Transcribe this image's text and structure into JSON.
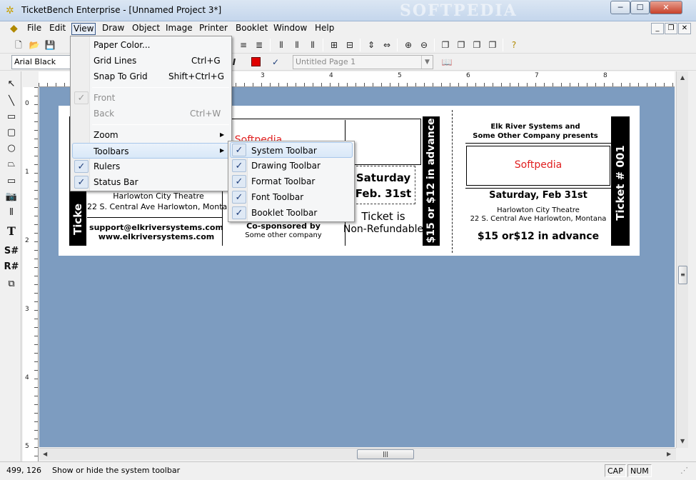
{
  "window": {
    "title": "TicketBench Enterprise - [Unnamed Project 3*]",
    "watermark": "SOFTPEDIA",
    "min": "─",
    "max": "☐",
    "close": "✕"
  },
  "menubar": {
    "items": [
      "File",
      "Edit",
      "View",
      "Draw",
      "Object",
      "Image",
      "Printer",
      "Booklet",
      "Window",
      "Help"
    ],
    "mdi": [
      "_",
      "❐",
      "✕"
    ]
  },
  "toolbar": {
    "font_name": "Arial Black",
    "page_name": "Untitled Page 1"
  },
  "view_menu": {
    "paper_color": "Paper Color...",
    "grid_lines": "Grid Lines",
    "grid_lines_sc": "Ctrl+G",
    "snap_to_grid": "Snap To Grid",
    "snap_to_grid_sc": "Shift+Ctrl+G",
    "front": "Front",
    "back": "Back",
    "back_sc": "Ctrl+W",
    "zoom": "Zoom",
    "toolbars": "Toolbars",
    "rulers": "Rulers",
    "status_bar": "Status Bar"
  },
  "toolbars_submenu": {
    "system": "System Toolbar",
    "drawing": "Drawing Toolbar",
    "format": "Format Toolbar",
    "font": "Font Toolbar",
    "booklet": "Booklet Toolbar"
  },
  "ruler": {
    "h": [
      "3",
      "4",
      "5",
      "6",
      "7",
      "8"
    ],
    "v": [
      "0",
      "1",
      "2",
      "3",
      "4",
      "5"
    ]
  },
  "ticket": {
    "left_stripe": "Ticke",
    "partial_softpedia": "Softpedia",
    "venue": "Harlowton City Theatre",
    "address": "22 S. Central Ave   Harlowton, Montana",
    "email": "support@elkriversystems.com",
    "web": "www.elkriversystems.com",
    "cosponsored": "Co-sponsored by",
    "other_company": "Some other company",
    "day": "Saturday",
    "date": "Feb. 31st",
    "ticket_is": "Ticket is",
    "non_refundable": "Non-Refundable",
    "price_vertical": "$15 or $12 in advance",
    "stub_presents_1": "Elk River Systems and",
    "stub_presents_2": "Some Other Company presents",
    "stub_softpedia": "Softpedia",
    "stub_date": "Saturday, Feb 31st",
    "stub_venue": "Harlowton City Theatre",
    "stub_address": "22 S. Central Ave   Harlowton, Montana",
    "stub_price": "$15 or$12 in advance",
    "stub_number": "Ticket # 001"
  },
  "status": {
    "coords": "499, 126",
    "message": "Show or hide the system toolbar",
    "cap": "CAP",
    "num": "NUM"
  },
  "colors": {
    "canvas": "#7d9cc0",
    "softpedia_red": "#e02020",
    "check": "#1f3e7a"
  }
}
